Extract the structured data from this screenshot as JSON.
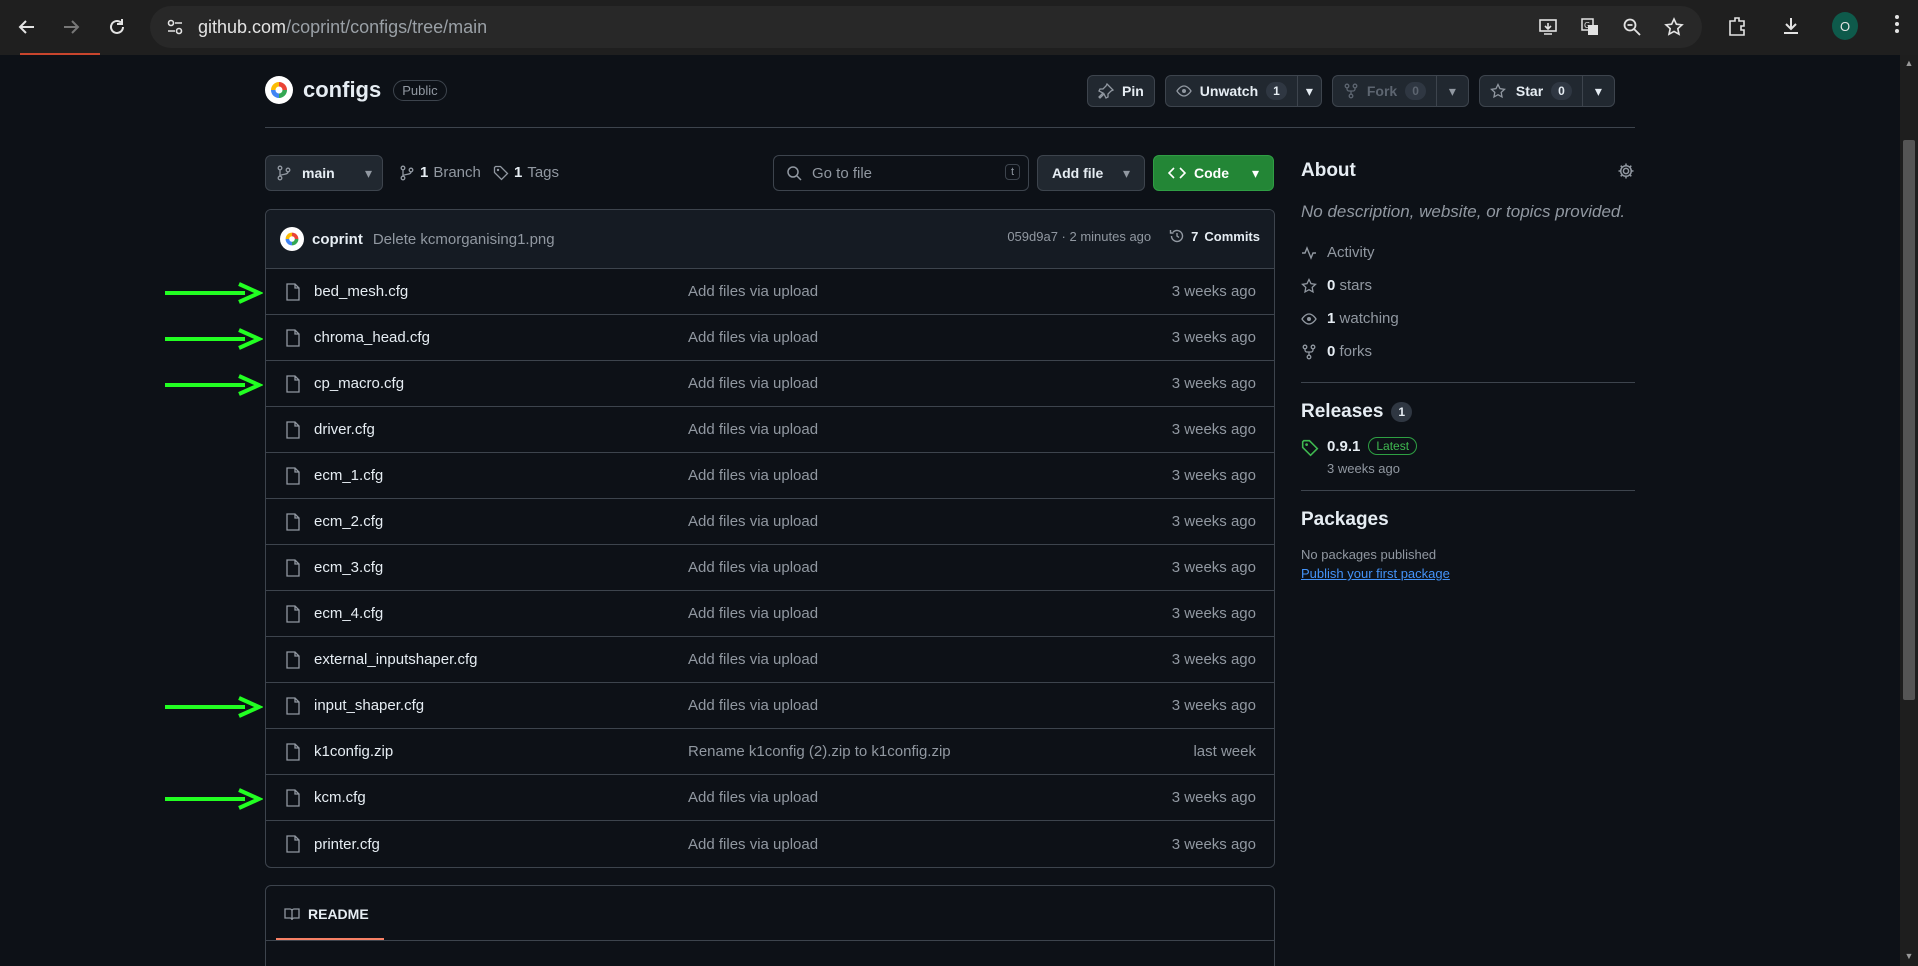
{
  "browser": {
    "url_host": "github.com",
    "url_path": "/coprint/configs/tree/main",
    "profile_initial": "O"
  },
  "repo": {
    "name": "configs",
    "visibility": "Public",
    "pin_label": "Pin",
    "unwatch_label": "Unwatch",
    "watch_count": "1",
    "fork_label": "Fork",
    "fork_count": "0",
    "star_label": "Star",
    "star_count": "0"
  },
  "toolbar": {
    "branch": "main",
    "branches_count": "1",
    "branches_label": "Branch",
    "tags_count": "1",
    "tags_label": "Tags",
    "search_placeholder": "Go to file",
    "search_shortcut": "t",
    "add_file_label": "Add file",
    "code_label": "Code"
  },
  "commit": {
    "author": "coprint",
    "message": "Delete kcmorganising1.png",
    "hash_time": "059d9a7 · 2 minutes ago",
    "commits_count": "7",
    "commits_label": "Commits"
  },
  "files": [
    {
      "name": "bed_mesh.cfg",
      "message": "Add files via upload",
      "time": "3 weeks ago",
      "marked": true
    },
    {
      "name": "chroma_head.cfg",
      "message": "Add files via upload",
      "time": "3 weeks ago",
      "marked": true
    },
    {
      "name": "cp_macro.cfg",
      "message": "Add files via upload",
      "time": "3 weeks ago",
      "marked": true
    },
    {
      "name": "driver.cfg",
      "message": "Add files via upload",
      "time": "3 weeks ago",
      "marked": false
    },
    {
      "name": "ecm_1.cfg",
      "message": "Add files via upload",
      "time": "3 weeks ago",
      "marked": false
    },
    {
      "name": "ecm_2.cfg",
      "message": "Add files via upload",
      "time": "3 weeks ago",
      "marked": false
    },
    {
      "name": "ecm_3.cfg",
      "message": "Add files via upload",
      "time": "3 weeks ago",
      "marked": false
    },
    {
      "name": "ecm_4.cfg",
      "message": "Add files via upload",
      "time": "3 weeks ago",
      "marked": false
    },
    {
      "name": "external_inputshaper.cfg",
      "message": "Add files via upload",
      "time": "3 weeks ago",
      "marked": false
    },
    {
      "name": "input_shaper.cfg",
      "message": "Add files via upload",
      "time": "3 weeks ago",
      "marked": true
    },
    {
      "name": "k1config.zip",
      "message": "Rename k1config (2).zip to k1config.zip",
      "time": "last week",
      "marked": false
    },
    {
      "name": "kcm.cfg",
      "message": "Add files via upload",
      "time": "3 weeks ago",
      "marked": true
    },
    {
      "name": "printer.cfg",
      "message": "Add files via upload",
      "time": "3 weeks ago",
      "marked": false
    }
  ],
  "readme": {
    "label": "README"
  },
  "about": {
    "title": "About",
    "description": "No description, website, or topics provided.",
    "activity_label": "Activity",
    "stars_count": "0",
    "stars_label": "stars",
    "watching_count": "1",
    "watching_label": "watching",
    "forks_count": "0",
    "forks_label": "forks"
  },
  "releases": {
    "title": "Releases",
    "count": "1",
    "version": "0.9.1",
    "badge": "Latest",
    "time": "3 weeks ago"
  },
  "packages": {
    "title": "Packages",
    "none_text": "No packages published",
    "link_text": "Publish your first package"
  },
  "colors": {
    "arrow": "#22ff22",
    "code_button": "#238636",
    "background": "#0d1117"
  }
}
